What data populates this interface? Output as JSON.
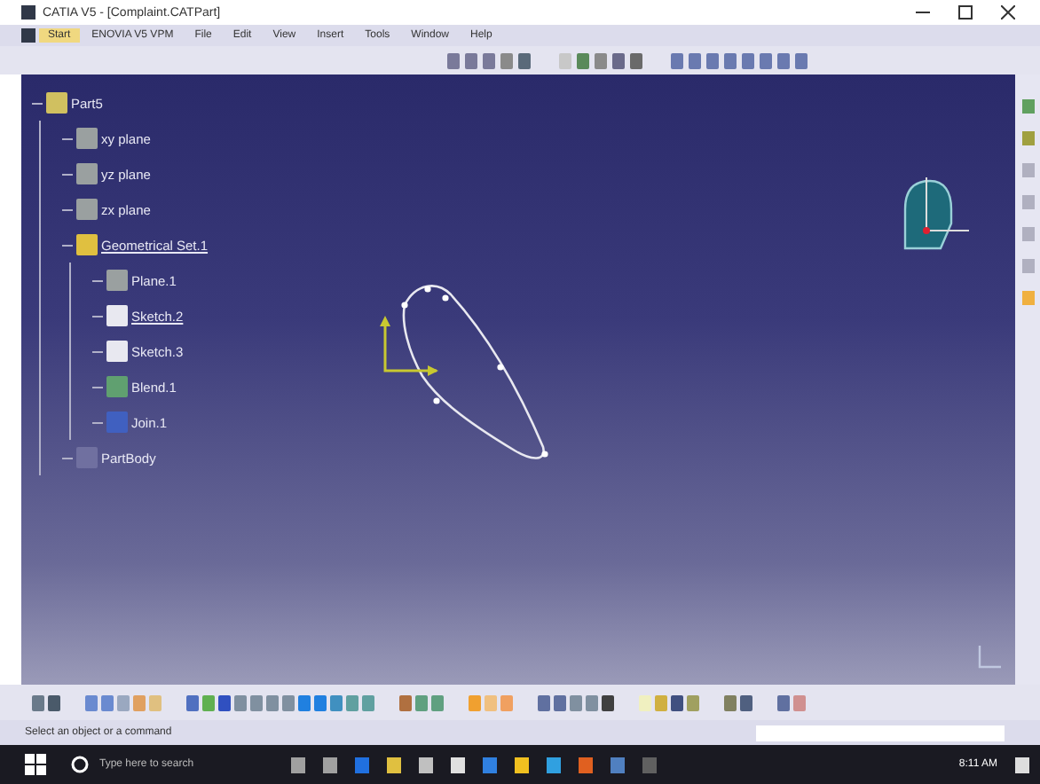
{
  "window": {
    "title": "CATIA V5 - [Complaint.CATPart]"
  },
  "menu": [
    {
      "label": "Start",
      "selected": true
    },
    {
      "label": "ENOVIA V5 VPM",
      "selected": false
    },
    {
      "label": "File",
      "selected": false
    },
    {
      "label": "Edit",
      "selected": false
    },
    {
      "label": "View",
      "selected": false
    },
    {
      "label": "Insert",
      "selected": false
    },
    {
      "label": "Tools",
      "selected": false
    },
    {
      "label": "Window",
      "selected": false
    },
    {
      "label": "Help",
      "selected": false
    }
  ],
  "tree": {
    "label": "Part5",
    "kind": "part",
    "underlined": false,
    "children": [
      {
        "label": "xy plane",
        "kind": "plane",
        "underlined": false
      },
      {
        "label": "yz plane",
        "kind": "plane",
        "underlined": false
      },
      {
        "label": "zx plane",
        "kind": "plane",
        "underlined": false
      },
      {
        "label": "Geometrical Set.1",
        "kind": "set",
        "underlined": true,
        "children": [
          {
            "label": "Plane.1",
            "kind": "plane",
            "underlined": false
          },
          {
            "label": "Sketch.2",
            "kind": "sketch",
            "underlined": true
          },
          {
            "label": "Sketch.3",
            "kind": "sketch",
            "underlined": false
          },
          {
            "label": "Blend.1",
            "kind": "blend",
            "underlined": false
          },
          {
            "label": "Join.1",
            "kind": "join",
            "underlined": false
          }
        ]
      },
      {
        "label": "PartBody",
        "kind": "body",
        "underlined": false
      }
    ]
  },
  "status_bar": {
    "message": "Select an object or a command"
  },
  "taskbar": {
    "search_placeholder": "Type here to search",
    "time": "8:11 AM"
  }
}
